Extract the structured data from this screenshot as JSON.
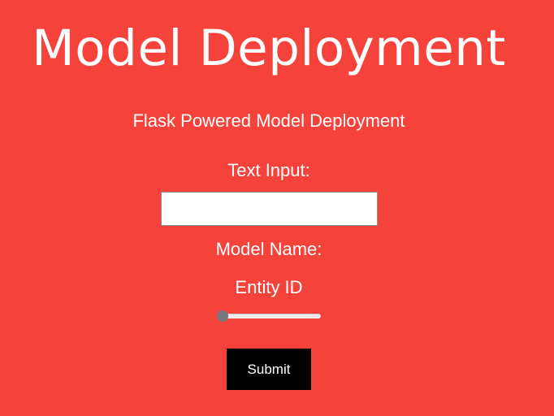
{
  "header": {
    "title": "Model Deployment",
    "subtitle": "Flask Powered Model Deployment"
  },
  "form": {
    "text_input_label": "Text Input:",
    "text_input_value": "",
    "model_name_label": "Model Name:",
    "model_name_value": "",
    "entity_label": "Entity ID",
    "slider_value_fraction": 0.0,
    "submit_label": "Submit"
  },
  "colors": {
    "background": "#f5423a",
    "text": "#ffffff",
    "button_background": "#000000",
    "slider_thumb": "#777777"
  }
}
